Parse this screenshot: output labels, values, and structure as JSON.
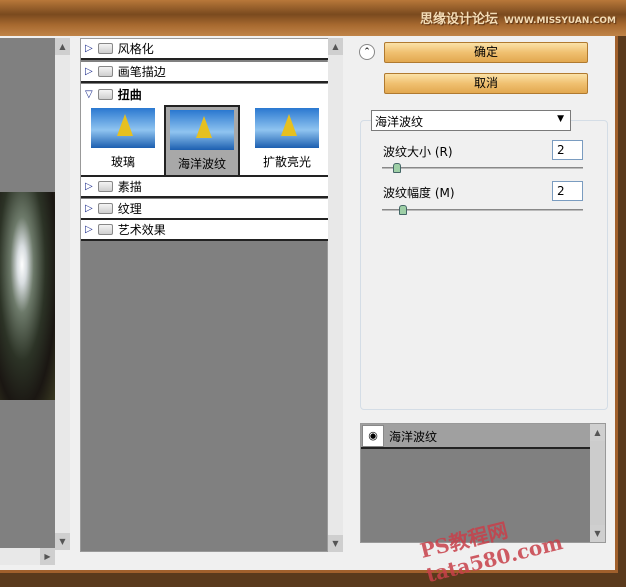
{
  "watermark_top": {
    "cn": "思缘设计论坛",
    "url": "WWW.MISSYUAN.COM"
  },
  "categories": [
    {
      "label": "风格化"
    },
    {
      "label": "画笔描边"
    },
    {
      "label": "扭曲",
      "expanded": true
    },
    {
      "label": "素描"
    },
    {
      "label": "纹理"
    },
    {
      "label": "艺术效果"
    }
  ],
  "thumbnails": [
    {
      "label": "玻璃"
    },
    {
      "label": "海洋波纹",
      "selected": true
    },
    {
      "label": "扩散亮光"
    }
  ],
  "buttons": {
    "ok": "确定",
    "cancel": "取消",
    "collapse": "⌃"
  },
  "filter_select": "海洋波纹",
  "params": [
    {
      "label": "波纹大小 (R)",
      "value": "2",
      "slider": 2
    },
    {
      "label": "波纹幅度 (M)",
      "value": "2",
      "slider": 2
    }
  ],
  "layers": [
    {
      "name": "海洋波纹"
    }
  ],
  "watermark_bottom": "PS教程网 tata580.com"
}
